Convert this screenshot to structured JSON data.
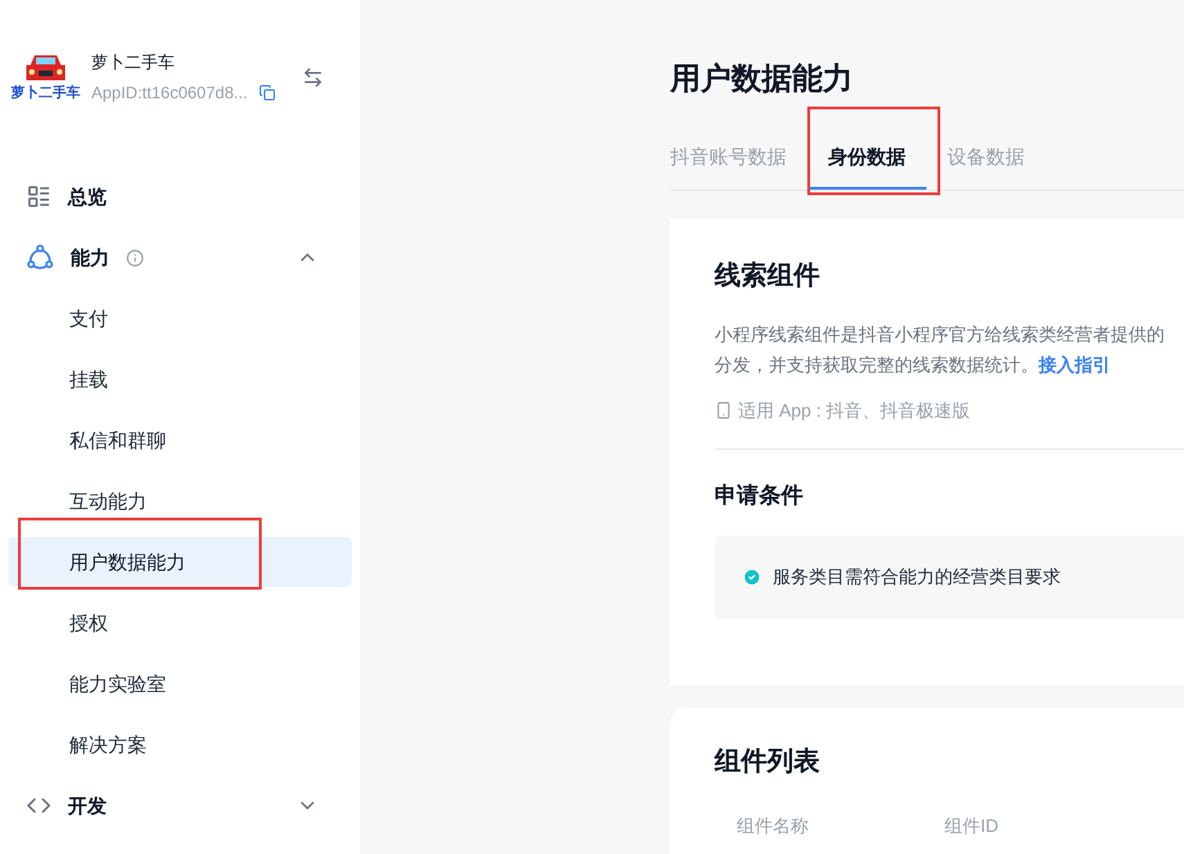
{
  "app": {
    "logo_text": "萝卜二手车",
    "name": "萝卜二手车",
    "app_id": "AppID:tt16c0607d8..."
  },
  "sidebar": {
    "items": [
      {
        "kind": "top",
        "label": "总览",
        "info": false
      },
      {
        "kind": "group",
        "label": "能力",
        "info": true,
        "expanded": true,
        "children": [
          {
            "label": "支付",
            "selected": false
          },
          {
            "label": "挂载",
            "selected": false
          },
          {
            "label": "私信和群聊",
            "selected": false
          },
          {
            "label": "互动能力",
            "selected": false
          },
          {
            "label": "用户数据能力",
            "selected": true
          },
          {
            "label": "授权",
            "selected": false
          },
          {
            "label": "能力实验室",
            "selected": false
          },
          {
            "label": "解决方案",
            "selected": false
          }
        ]
      },
      {
        "kind": "group",
        "label": "开发",
        "info": false,
        "expanded": false
      }
    ]
  },
  "page": {
    "title": "用户数据能力",
    "tabs": [
      {
        "label": "抖音账号数据",
        "selected": false
      },
      {
        "label": "身份数据",
        "selected": true
      },
      {
        "label": "设备数据",
        "selected": false
      }
    ],
    "card": {
      "title": "线索组件",
      "description_lines": [
        "小程序线索组件是抖音小程序官方给线索类经营者提供的",
        "分发，并支持获取完整的线索数据统计。"
      ],
      "link": "接入指引",
      "applicable": "适用 App : 抖音、抖音极速版",
      "conditions_title": "申请条件",
      "conditions": [
        "服务类目需符合能力的经营类目要求"
      ]
    },
    "list_card": {
      "title": "组件列表",
      "columns": [
        "组件名称",
        "组件ID"
      ]
    }
  }
}
